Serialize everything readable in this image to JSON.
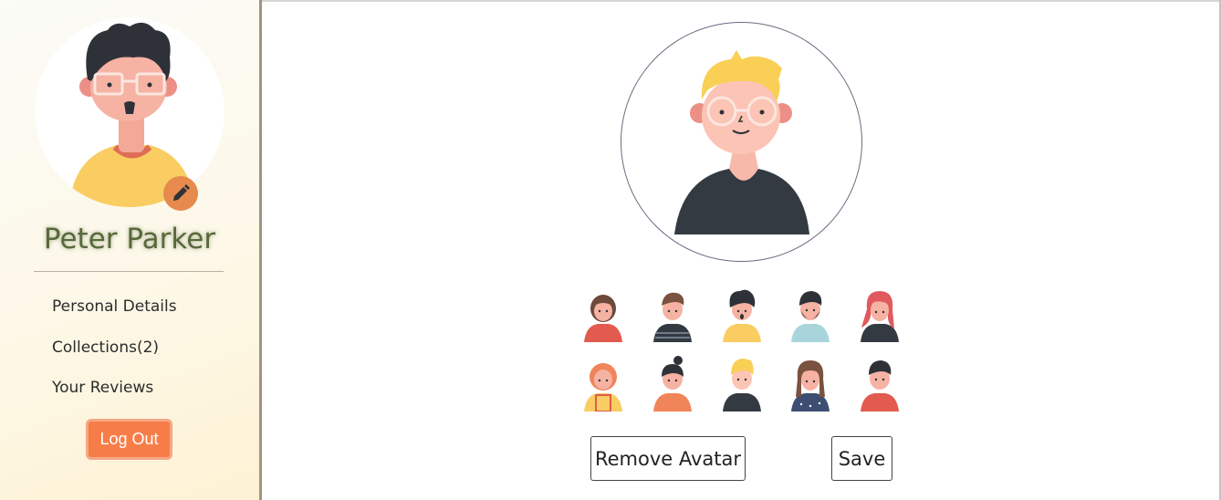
{
  "profile": {
    "name": "Peter Parker",
    "avatar": "avatar-curly-hair-glasses-yellow-shirt",
    "edit_icon": "pencil-icon"
  },
  "sidebar": {
    "items": [
      {
        "label": "Personal Details"
      },
      {
        "label": "Collections(2)"
      },
      {
        "label": "Your Reviews"
      }
    ],
    "logout_label": "Log Out"
  },
  "selected_avatar": "avatar-blonde-glasses-dark-shirt",
  "avatar_options": [
    "avatar-girl-brown-hair-red-shirt",
    "avatar-boy-brown-hair-striped-shirt",
    "avatar-boy-curly-hair-yellow-shirt",
    "avatar-man-beard-light-blue-shirt",
    "avatar-woman-red-hair-dark-shirt",
    "avatar-girl-orange-hair-yellow-overalls",
    "avatar-woman-bun-orange-top",
    "avatar-boy-blonde-dark-shirt",
    "avatar-woman-long-hair-dotted-shirt",
    "avatar-boy-dark-hair-red-shirt"
  ],
  "actions": {
    "remove_label": "Remove Avatar",
    "save_label": "Save"
  },
  "colors": {
    "accent": "#f77d48",
    "name_color": "#57693a",
    "edit_button": "#e68a4e"
  }
}
